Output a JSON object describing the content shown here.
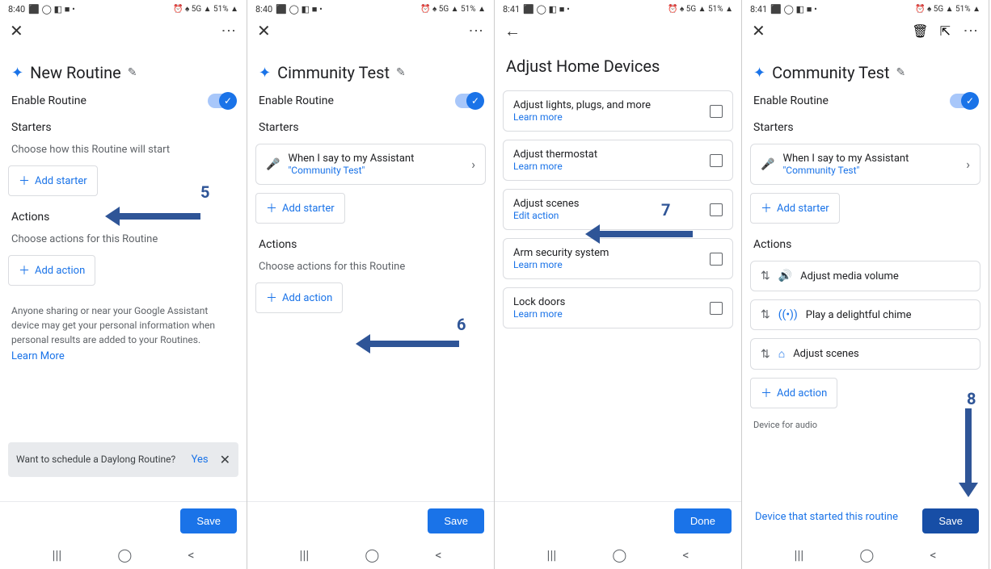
{
  "status": {
    "time1": "8:40",
    "time2": "8:41",
    "icons": "⏰ ♠ 5G ▲ 51% ▲",
    "left_icons": "⬛ ◯ ◧ ■ •"
  },
  "screen1": {
    "title": "New Routine",
    "enable": "Enable Routine",
    "starters": "Starters",
    "starter_hint": "Choose how this Routine will start",
    "add_starter": "Add starter",
    "actions": "Actions",
    "action_hint": "Choose actions for this Routine",
    "add_action": "Add action",
    "disclaimer": "Anyone sharing or near your Google Assistant device may get your personal information when personal results are added to your Routines.",
    "learn_more": "Learn More",
    "snack_text": "Want to schedule a Daylong Routine?",
    "snack_yes": "Yes",
    "save": "Save"
  },
  "screen2": {
    "title": "Cimmunity Test",
    "enable": "Enable Routine",
    "starters": "Starters",
    "starter_line": "When I say to my Assistant",
    "starter_val": "\"Community Test\"",
    "add_starter": "Add starter",
    "actions": "Actions",
    "action_hint": "Choose actions for this Routine",
    "add_action": "Add action",
    "save": "Save"
  },
  "screen3": {
    "title": "Adjust Home Devices",
    "items": [
      {
        "label": "Adjust lights, plugs, and more",
        "sub": "Learn more"
      },
      {
        "label": "Adjust thermostat",
        "sub": "Learn more"
      },
      {
        "label": "Adjust scenes",
        "sub": "Edit action"
      },
      {
        "label": "Arm security system",
        "sub": "Learn more"
      },
      {
        "label": "Lock doors",
        "sub": "Learn more"
      }
    ],
    "done": "Done"
  },
  "screen4": {
    "title": "Community Test",
    "enable": "Enable Routine",
    "starters": "Starters",
    "starter_line": "When I say to my Assistant",
    "starter_val": "\"Community Test\"",
    "add_starter": "Add starter",
    "actions": "Actions",
    "action_items": [
      "Adjust media volume",
      "Play a delightful chime",
      "Adjust scenes"
    ],
    "add_action": "Add action",
    "device_for": "Device for audio",
    "device_link": "Device that started this routine",
    "save": "Save"
  },
  "annotations": {
    "n5": "5",
    "n6": "6",
    "n7": "7",
    "n8": "8"
  }
}
